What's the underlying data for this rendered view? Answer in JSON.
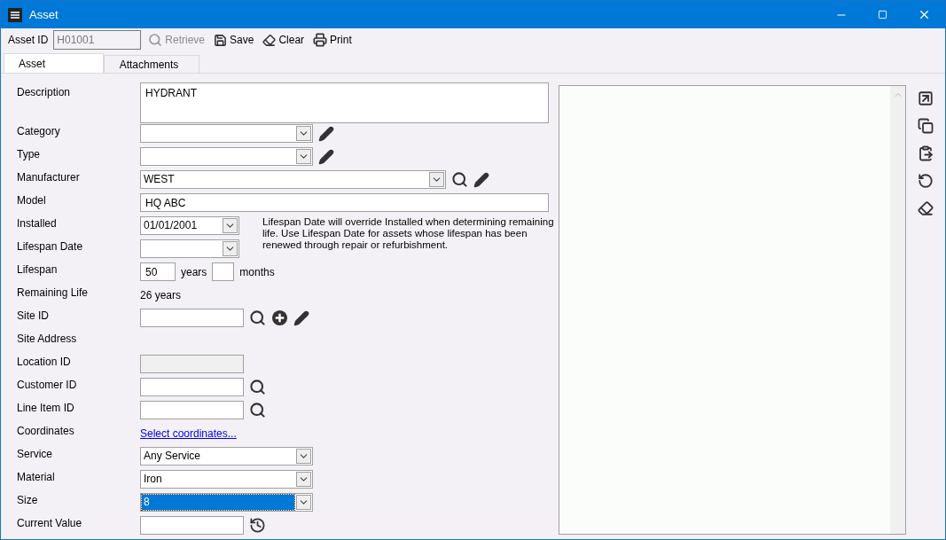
{
  "window": {
    "title": "Asset"
  },
  "toolbar": {
    "asset_id_label": "Asset ID",
    "asset_id_value": "H01001",
    "buttons": [
      {
        "kind": "retrieve",
        "label": "Retrieve",
        "disabled": true
      },
      {
        "kind": "save",
        "label": "Save",
        "disabled": false
      },
      {
        "kind": "clear",
        "label": "Clear",
        "disabled": false
      },
      {
        "kind": "print",
        "label": "Print",
        "disabled": false
      }
    ]
  },
  "tabs": [
    {
      "label": "Asset",
      "selected": true
    },
    {
      "label": "Attachments",
      "selected": false
    }
  ],
  "form": {
    "rows": [
      {
        "label": "Description",
        "kind": "textarea",
        "value": "HYDRANT"
      },
      {
        "label": "Category",
        "kind": "combo",
        "value": "",
        "tools": [
          {
            "kind": "edit"
          }
        ]
      },
      {
        "label": "Type",
        "kind": "combo",
        "value": "",
        "tools": [
          {
            "kind": "edit"
          }
        ]
      },
      {
        "label": "Manufacturer",
        "kind": "long-combo",
        "value": "WEST",
        "tools": [
          {
            "kind": "search"
          },
          {
            "kind": "edit"
          }
        ]
      },
      {
        "label": "Model",
        "kind": "text",
        "value": "HQ ABC"
      },
      {
        "label": "Installed",
        "kind": "date",
        "value": "01/01/2001",
        "note": "Lifespan Date will override Installed when determining remaining life. Use Lifespan Date for assets whose lifespan has been renewed through repair or refurbishment."
      },
      {
        "label": "Lifespan Date",
        "kind": "date",
        "value": ""
      },
      {
        "label": "Lifespan",
        "kind": "lifespan",
        "years": "50",
        "years_label": "years",
        "months": "",
        "months_label": "months"
      },
      {
        "label": "Remaining Life",
        "kind": "static",
        "value": "26 years"
      },
      {
        "label": "Site ID",
        "kind": "short-text",
        "value": "",
        "tools": [
          {
            "kind": "search"
          },
          {
            "kind": "add"
          },
          {
            "kind": "edit"
          }
        ]
      },
      {
        "label": "Site Address",
        "kind": "label"
      },
      {
        "label": "Location ID",
        "kind": "short-text",
        "value": "",
        "disabled": true
      },
      {
        "label": "Customer ID",
        "kind": "short-text",
        "value": "",
        "tools": [
          {
            "kind": "search"
          }
        ]
      },
      {
        "label": "Line Item ID",
        "kind": "short-text",
        "value": "",
        "tools": [
          {
            "kind": "search"
          }
        ]
      },
      {
        "label": "Coordinates",
        "kind": "link",
        "value": "Select coordinates..."
      },
      {
        "label": "Service",
        "kind": "combo",
        "value": "Any Service"
      },
      {
        "label": "Material",
        "kind": "combo",
        "value": "Iron"
      },
      {
        "label": "Size",
        "kind": "combo",
        "value": "8",
        "selected": true
      },
      {
        "label": "Current Value",
        "kind": "short-text",
        "value": "",
        "tools": [
          {
            "kind": "history"
          }
        ]
      }
    ]
  },
  "side_tools": [
    {
      "kind": "expand"
    },
    {
      "kind": "copy"
    },
    {
      "kind": "paste"
    },
    {
      "kind": "rotate"
    },
    {
      "kind": "erase"
    }
  ]
}
